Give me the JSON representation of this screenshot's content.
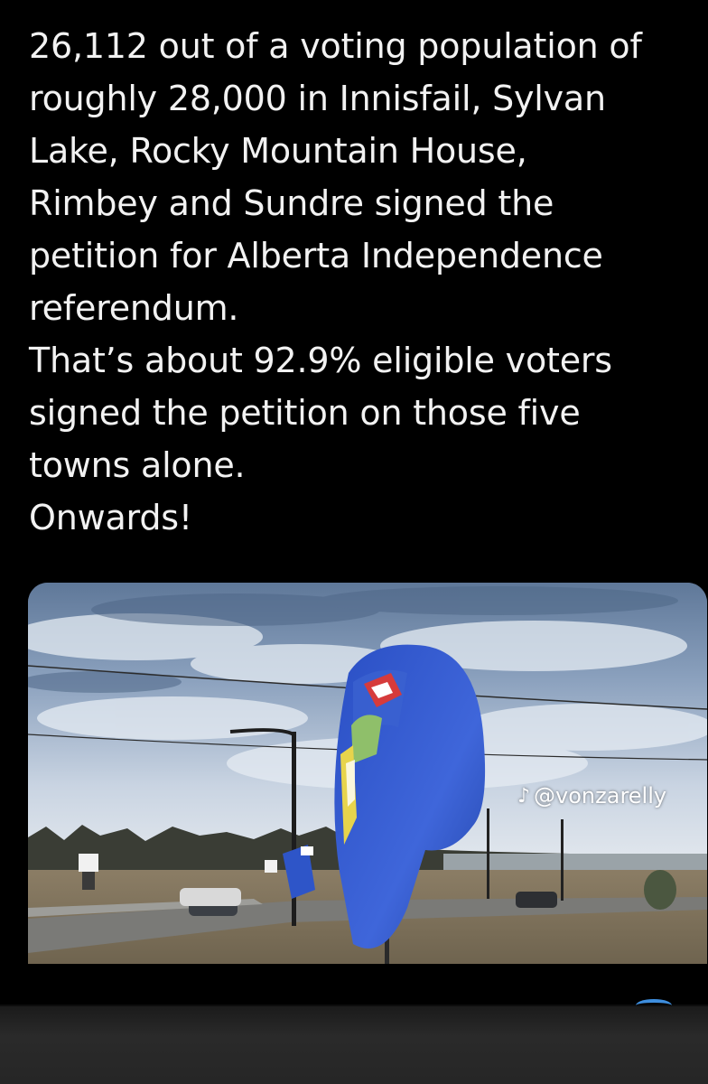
{
  "post": {
    "text": "26,112 out of a voting population of\nroughly 28,000 in Innisfail, Sylvan\nLake, Rocky Mountain House,\nRimbey and Sundre signed the\npetition for Alberta Independence\nreferendum.\nThat’s about 92.9% eligible voters\nsigned the petition on those five\ntowns alone.\nOnwards!"
  },
  "media": {
    "watermark_handle": "@vonzarelly",
    "watermark_icon": "tiktok-icon"
  },
  "colors": {
    "background": "#000000",
    "text": "#f2f2f2",
    "flag_blue": "#2f55c8",
    "accent_blue": "#3e8ede"
  }
}
